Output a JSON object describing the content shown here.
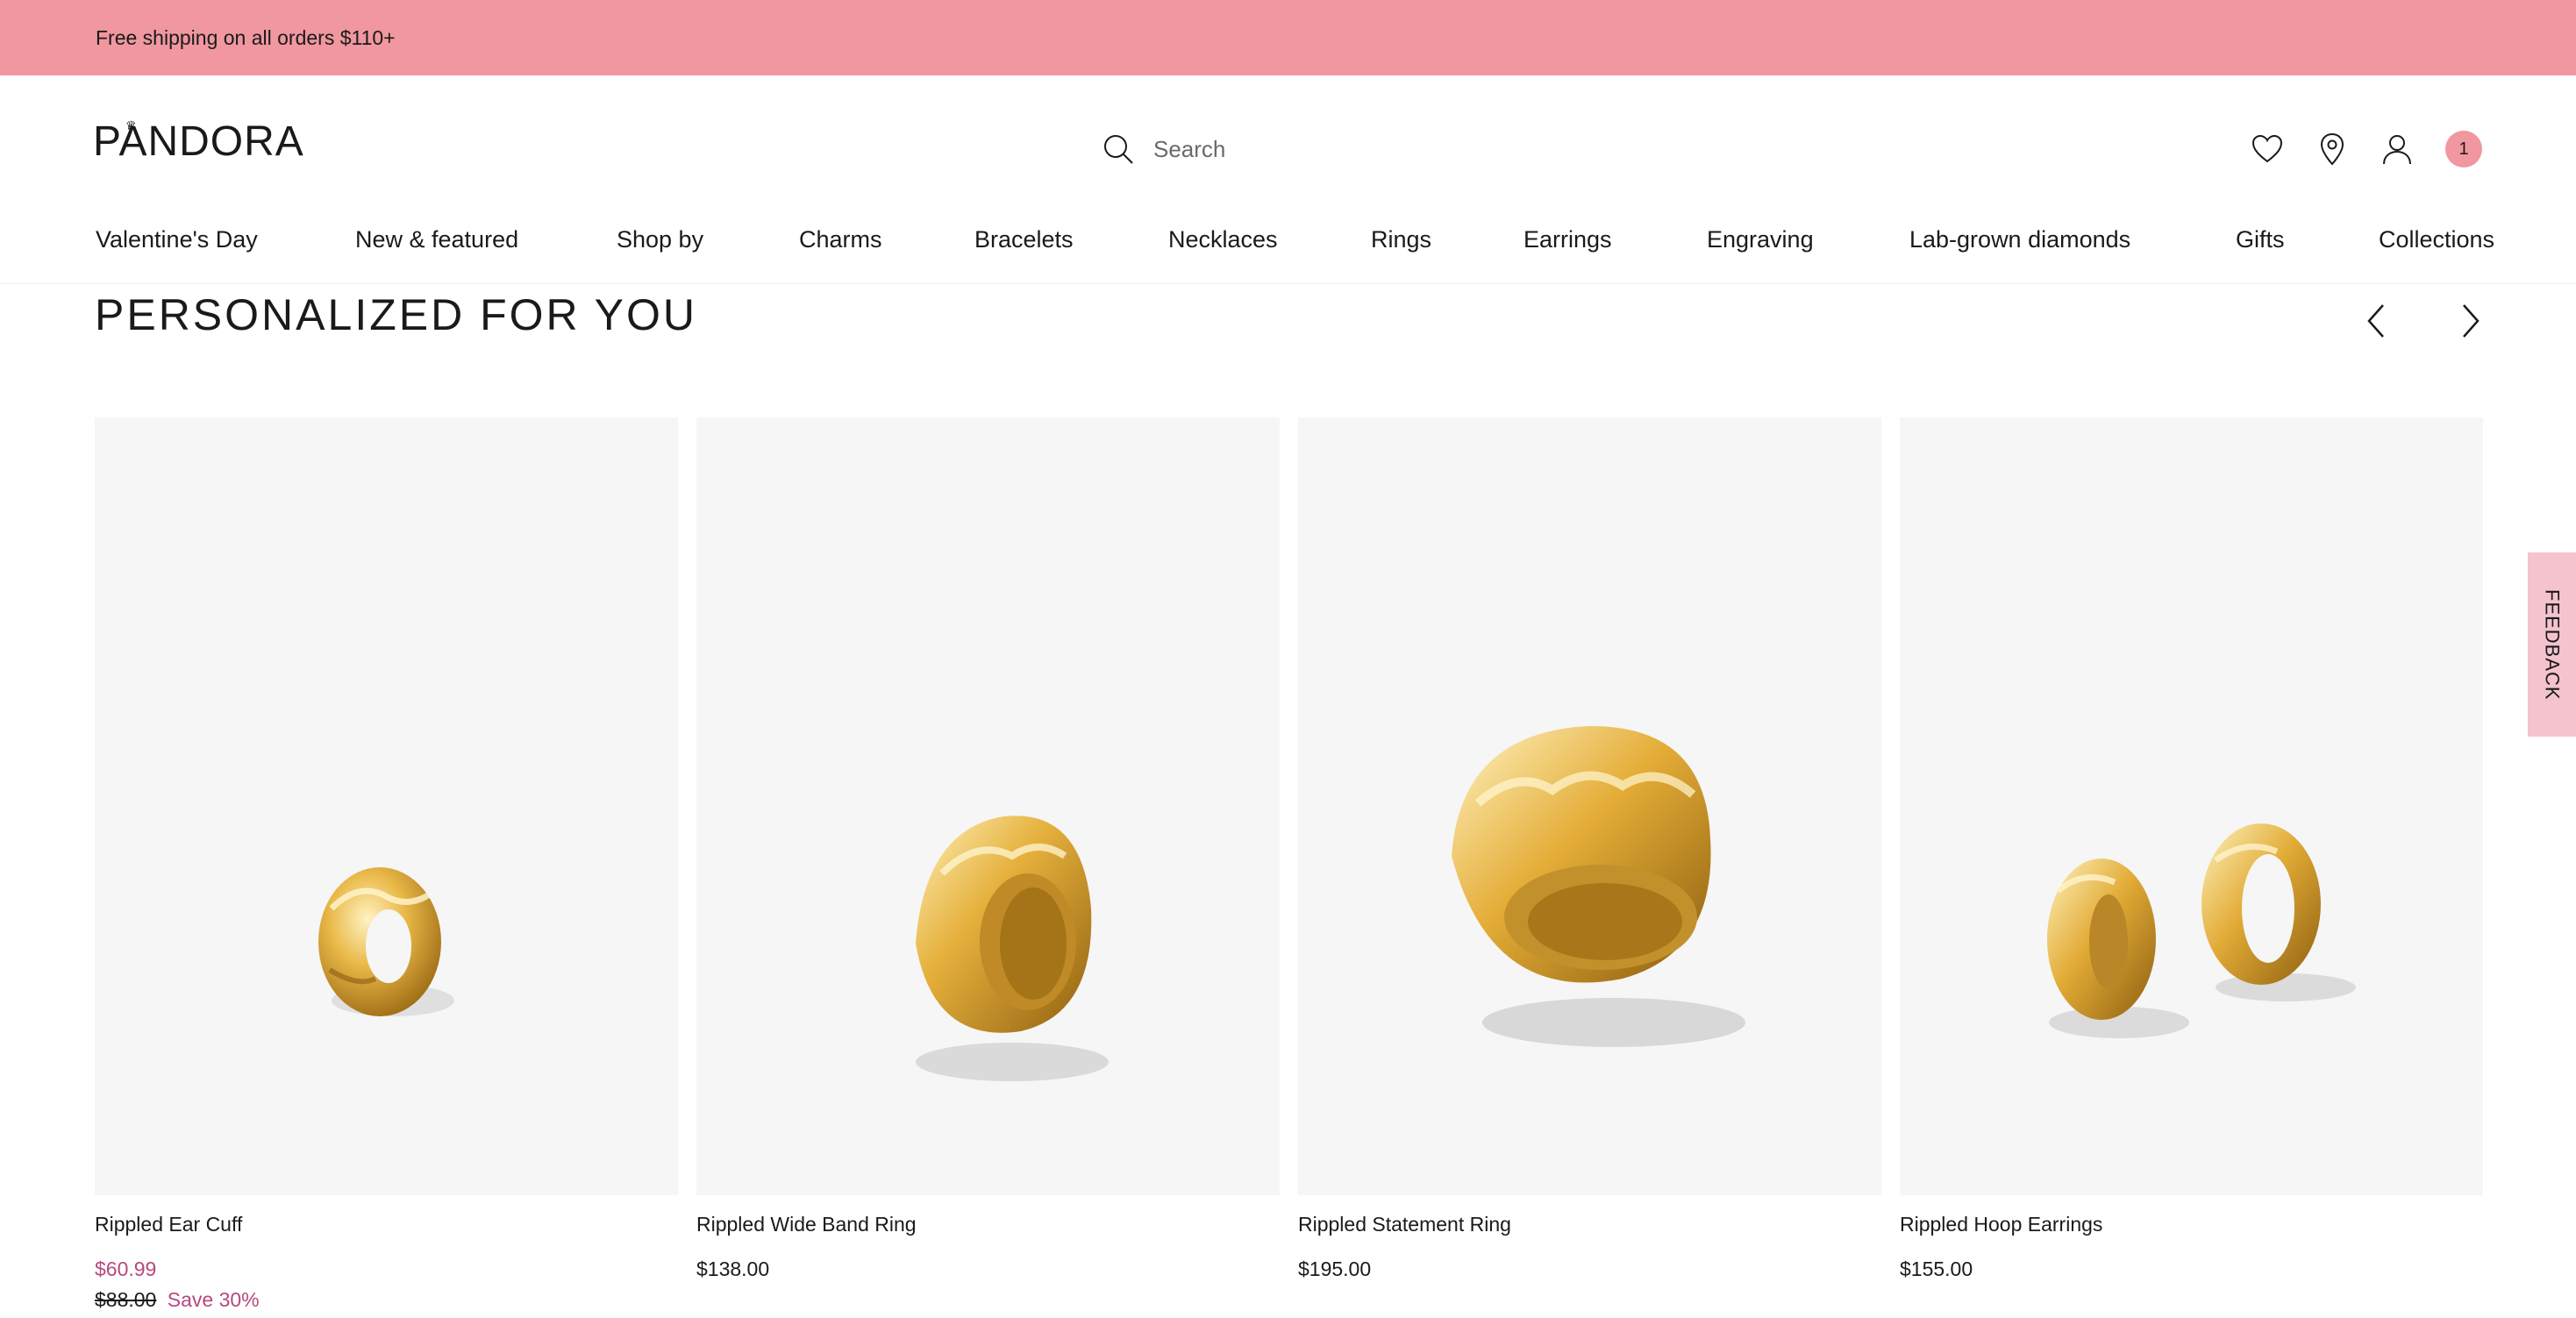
{
  "promo": {
    "text": "Free shipping on all orders $110+"
  },
  "header": {
    "logo": "PANDORA",
    "search_placeholder": "Search",
    "cart_count": "1",
    "icons": [
      "heart-icon",
      "location-pin-icon",
      "account-icon",
      "cart-badge"
    ]
  },
  "nav": {
    "items": [
      "Valentine's Day",
      "New & featured",
      "Shop by",
      "Charms",
      "Bracelets",
      "Necklaces",
      "Rings",
      "Earrings",
      "Engraving",
      "Lab-grown diamonds",
      "Gifts",
      "Collections"
    ]
  },
  "section": {
    "title": "PERSONALIZED FOR YOU"
  },
  "products": [
    {
      "name": "Rippled Ear Cuff",
      "price": "$60.99",
      "original_price": "$88.00",
      "save": "Save 30%"
    },
    {
      "name": "Rippled Wide Band Ring",
      "price": "$138.00"
    },
    {
      "name": "Rippled Statement Ring",
      "price": "$195.00"
    },
    {
      "name": "Rippled Hoop Earrings",
      "price": "$155.00"
    }
  ],
  "feedback": {
    "label": "FEEDBACK"
  },
  "colors": {
    "promo_bar": "#f0979f",
    "sale_price": "#b6497f",
    "feedback_tab": "#f4c3cd",
    "card_bg": "#f6f6f6",
    "gold": "#d9a530"
  }
}
